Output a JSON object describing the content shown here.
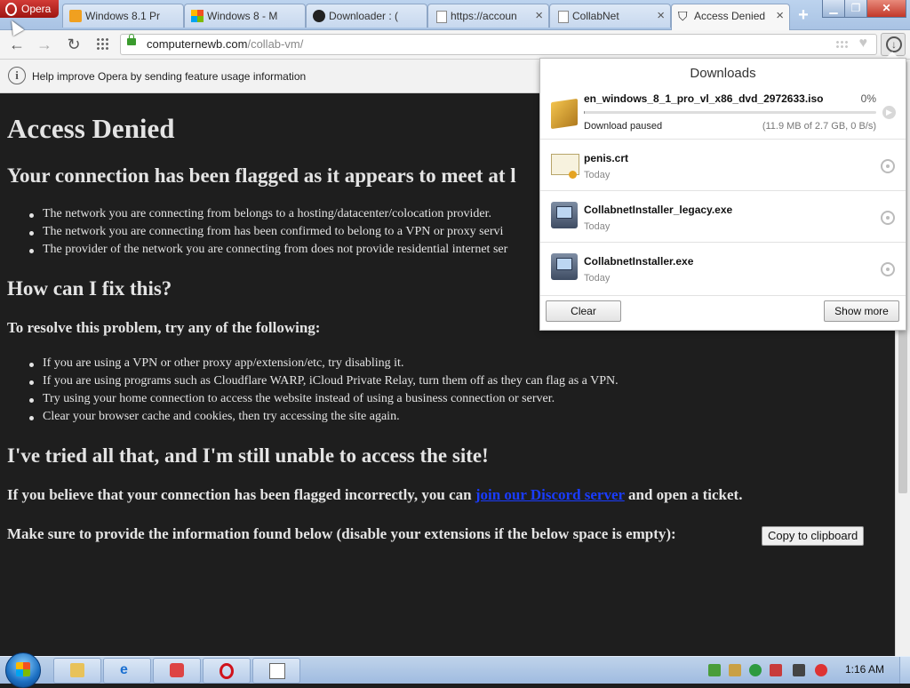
{
  "browser": {
    "menu_label": "Opera",
    "tabs": [
      {
        "title": "Windows 8.1 Pr",
        "favicon": "windows-8.1-icon"
      },
      {
        "title": "Windows 8 - M",
        "favicon": "windows-logo-icon"
      },
      {
        "title": "Downloader : (",
        "favicon": "github-icon"
      },
      {
        "title": "https://accoun",
        "favicon": "document-icon"
      },
      {
        "title": "CollabNet",
        "favicon": "document-icon"
      },
      {
        "title": "Access Denied",
        "favicon": "shield-icon",
        "active": true
      }
    ],
    "address": {
      "host": "computernewb.com",
      "path": "/collab-vm/"
    },
    "infobar_text": "Help improve Opera by sending feature usage information"
  },
  "page": {
    "title": "Access Denied",
    "flagged_heading": "Your connection has been flagged as it appears to meet at l",
    "reasons": [
      "The network you are connecting from belongs to a hosting/datacenter/colocation provider.",
      "The network you are connecting from has been confirmed to belong to a VPN or proxy servi",
      "The provider of the network you are connecting from does not provide residential internet ser"
    ],
    "fix_heading": "How can I fix this?",
    "resolve_heading": "To resolve this problem, try any of the following:",
    "fixes": [
      "If you are using a VPN or other proxy app/extension/etc, try disabling it.",
      "If you are using programs such as Cloudflare WARP, iCloud Private Relay, turn them off as they can flag as a VPN.",
      "Try using your home connection to access the website instead of using a business connection or server.",
      "Clear your browser cache and cookies, then try accessing the site again."
    ],
    "tried_heading": "I've tried all that, and I'm still unable to access the site!",
    "incorrect_prefix": "If you believe that your connection has been flagged incorrectly, you can ",
    "incorrect_link": "join our Discord server",
    "incorrect_suffix": " and open a ticket.",
    "provide_text": "Make sure to provide the information found below (disable your extensions if the below space is empty):",
    "copy_button": "Copy to clipboard"
  },
  "downloads": {
    "title": "Downloads",
    "items": [
      {
        "name": "en_windows_8_1_pro_vl_x86_dvd_2972633.iso",
        "status": "Download paused",
        "percent": "0%",
        "progress": 0.004,
        "size": "(11.9 MB of 2.7 GB, 0 B/s)",
        "icon": "package-icon"
      },
      {
        "name": "penis.crt",
        "status": "Today",
        "icon": "certificate-icon"
      },
      {
        "name": "CollabnetInstaller_legacy.exe",
        "status": "Today",
        "icon": "installer-icon"
      },
      {
        "name": "CollabnetInstaller.exe",
        "status": "Today",
        "icon": "installer-icon"
      }
    ],
    "clear_label": "Clear",
    "show_more_label": "Show more"
  },
  "taskbar": {
    "clock": "1:16 AM"
  }
}
